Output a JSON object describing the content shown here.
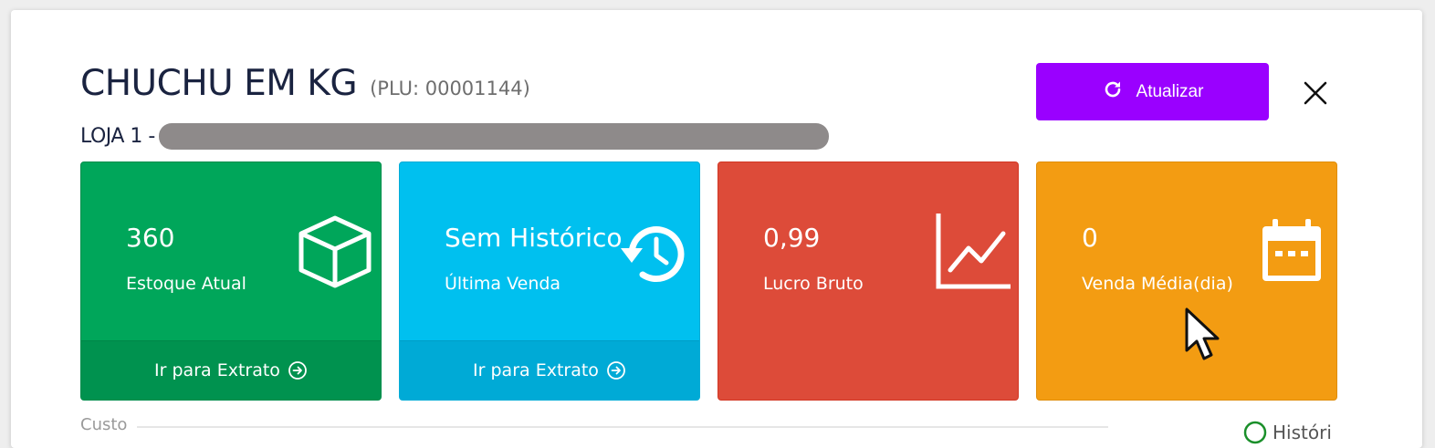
{
  "modal": {
    "title": "CHUCHU EM KG",
    "plu": "(PLU: 00001144)",
    "store_label": "LOJA 1 -",
    "update_button": "Atualizar",
    "close_button": "X"
  },
  "cards": [
    {
      "value": "360",
      "label": "Estoque Atual",
      "footer": "Ir para Extrato",
      "icon": "box-icon",
      "color": "#00a65a"
    },
    {
      "value": "Sem Histórico",
      "label": "Última Venda",
      "footer": "Ir para Extrato",
      "icon": "history-icon",
      "color": "#00c0ef"
    },
    {
      "value": "0,99",
      "label": "Lucro Bruto",
      "icon": "line-chart-icon",
      "color": "#dd4b39"
    },
    {
      "value": "0",
      "label": "Venda Média(dia)",
      "icon": "calendar-icon",
      "color": "#f39c12"
    }
  ],
  "bottom": {
    "custo_label": "Custo",
    "history_link": "Históri"
  },
  "colors": {
    "accent": "#9a00ff",
    "title": "#1a2340"
  }
}
